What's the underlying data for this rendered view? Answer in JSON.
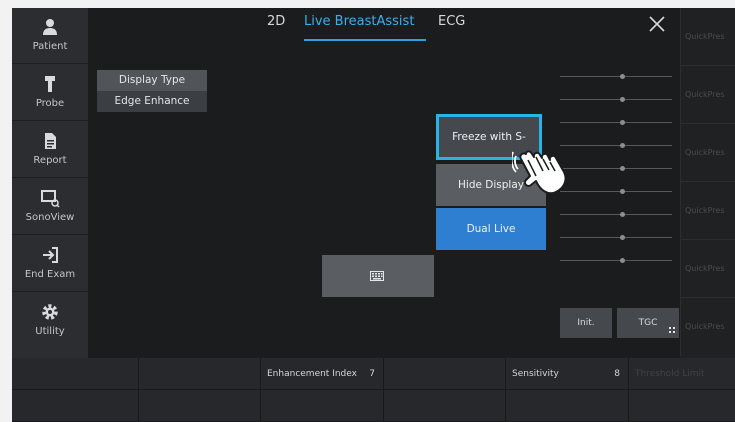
{
  "sidebar": {
    "items": [
      {
        "label": "Patient",
        "icon": "person-icon"
      },
      {
        "label": "Probe",
        "icon": "probe-icon"
      },
      {
        "label": "Report",
        "icon": "document-icon"
      },
      {
        "label": "SonoView",
        "icon": "sonoview-icon"
      },
      {
        "label": "End Exam",
        "icon": "exit-icon"
      },
      {
        "label": "Utility",
        "icon": "gear-icon"
      }
    ]
  },
  "tabs": [
    {
      "label": "2D",
      "active": false
    },
    {
      "label": "Live BreastAssist",
      "active": true
    },
    {
      "label": "ECG",
      "active": false
    }
  ],
  "display_type": {
    "title": "Display Type",
    "value": "Edge Enhance"
  },
  "buttons": {
    "freeze": "Freeze with S-Detect",
    "hide": "Hide Display",
    "dual": "Dual Live",
    "keyboard_icon": "keyboard-icon"
  },
  "tgc": {
    "init": "Init.",
    "tgc": "TGC",
    "slider_count": 9
  },
  "quick_presets": [
    "QuickPres",
    "QuickPres",
    "QuickPres",
    "QuickPres",
    "QuickPres",
    "QuickPres"
  ],
  "bottom": {
    "enhancement_label": "Enhancement Index",
    "enhancement_value": "7",
    "sensitivity_label": "Sensitivity",
    "sensitivity_value": "8",
    "threshold_label": "Threshold Limit"
  },
  "colors": {
    "accent": "#2f9fe0",
    "dual_live": "#2e7fd1",
    "focus_border": "#29b4e8"
  }
}
